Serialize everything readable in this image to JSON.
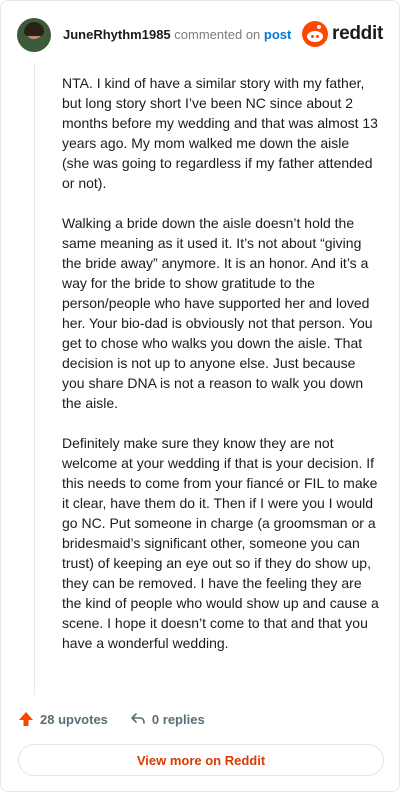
{
  "header": {
    "username": "JuneRhythm1985",
    "action_text": "commented on",
    "post_link": "post",
    "brand": "reddit"
  },
  "comment": {
    "paragraphs": [
      "NTA. I kind of have a similar story with my father, but long story short I’ve been NC since about 2 months before my wedding and that was almost 13 years ago. My mom walked me down the aisle (she was going to regardless if my father attended or not).",
      "Walking a bride down the aisle doesn’t hold the same meaning as it used it. It’s not about “giving the bride away” anymore. It is an honor. And it’s a way for the bride to show gratitude to the person/people who have supported her and loved her. Your bio-dad is obviously not that person. You get to chose who walks you down the aisle. That decision is not up to anyone else. Just because you share DNA is not a reason to walk you down the aisle.",
      "Definitely make sure they know they are not welcome at your wedding if that is your decision. If this needs to come from your fiancé or FIL to make it clear, have them do it. Then if I were you I would go NC. Put someone in charge (a groomsman or a bridesmaid’s significant other, someone you can trust) of keeping an eye out so if they do show up, they can be removed. I have the feeling they are the kind of people who would show up and cause a scene. I hope it doesn’t come to that and that you have a wonderful wedding."
    ]
  },
  "actions": {
    "upvotes_label": "28 upvotes",
    "replies_label": "0 replies"
  },
  "footer": {
    "view_more_label": "View more on Reddit"
  },
  "colors": {
    "accent": "#ff4500",
    "link": "#0079d3",
    "button_text": "#d93a00"
  },
  "icons": {
    "upvote": "upvote-arrow-icon",
    "reply": "reply-arrow-icon",
    "brand": "reddit-snoo-icon"
  }
}
